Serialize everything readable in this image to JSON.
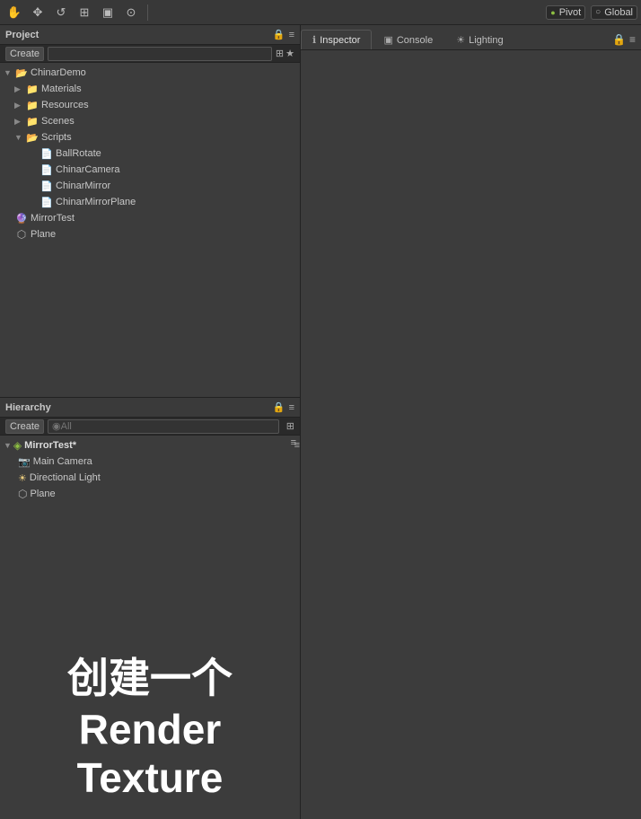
{
  "toolbar": {
    "icons": [
      "✋",
      "+",
      "↺",
      "⊞",
      "▣",
      "⊙"
    ],
    "pivot_label": "Pivot",
    "global_label": "Global"
  },
  "project_panel": {
    "title": "Project",
    "create_label": "Create",
    "search_placeholder": "",
    "tree": [
      {
        "id": "chinarDemo",
        "label": "ChinarDemo",
        "type": "folder",
        "depth": 0,
        "expanded": true,
        "arrow": "▼"
      },
      {
        "id": "materials",
        "label": "Materials",
        "type": "folder",
        "depth": 1,
        "expanded": false,
        "arrow": "▶"
      },
      {
        "id": "resources",
        "label": "Resources",
        "type": "folder",
        "depth": 1,
        "expanded": false,
        "arrow": "▶"
      },
      {
        "id": "scenes",
        "label": "Scenes",
        "type": "folder",
        "depth": 1,
        "expanded": false,
        "arrow": "▶"
      },
      {
        "id": "scripts",
        "label": "Scripts",
        "type": "folder",
        "depth": 1,
        "expanded": true,
        "arrow": "▼"
      },
      {
        "id": "ballRotate",
        "label": "BallRotate",
        "type": "script",
        "depth": 2,
        "arrow": ""
      },
      {
        "id": "chinarCamera",
        "label": "ChinarCamera",
        "type": "script",
        "depth": 2,
        "arrow": ""
      },
      {
        "id": "chinarMirror",
        "label": "ChinarMirror",
        "type": "script",
        "depth": 2,
        "arrow": ""
      },
      {
        "id": "chinarMirrorPlane",
        "label": "ChinarMirrorPlane",
        "type": "script",
        "depth": 2,
        "arrow": ""
      },
      {
        "id": "mirrorTest",
        "label": "MirrorTest",
        "type": "scene",
        "depth": 0,
        "arrow": ""
      },
      {
        "id": "plane",
        "label": "Plane",
        "type": "mesh",
        "depth": 0,
        "arrow": ""
      }
    ]
  },
  "hierarchy_panel": {
    "title": "Hierarchy",
    "create_label": "Create",
    "search_placeholder": "◉All",
    "items": [
      {
        "id": "mirrorTestScene",
        "label": "MirrorTest*",
        "type": "scene",
        "depth": 0,
        "arrow": "▼"
      },
      {
        "id": "mainCamera",
        "label": "Main Camera",
        "type": "camera",
        "depth": 1,
        "arrow": ""
      },
      {
        "id": "directionalLight",
        "label": "Directional Light",
        "type": "light",
        "depth": 1,
        "arrow": ""
      },
      {
        "id": "plane",
        "label": "Plane",
        "type": "mesh",
        "depth": 1,
        "arrow": ""
      }
    ]
  },
  "big_text": "创建一个Render Texture",
  "right_panel": {
    "tabs": [
      {
        "id": "inspector",
        "label": "Inspector",
        "icon": "ℹ",
        "active": true
      },
      {
        "id": "console",
        "label": "Console",
        "icon": "▣",
        "active": false
      },
      {
        "id": "lighting",
        "label": "Lighting",
        "icon": "☀",
        "active": false
      }
    ]
  },
  "icons": {
    "folder_open": "📂",
    "folder_closed": "📁",
    "script": "📄",
    "scene": "🔮",
    "camera": "📷",
    "light": "💡",
    "mesh": "⬡",
    "lock": "🔒",
    "menu": "≡",
    "filter": "⊞",
    "star": "★"
  }
}
